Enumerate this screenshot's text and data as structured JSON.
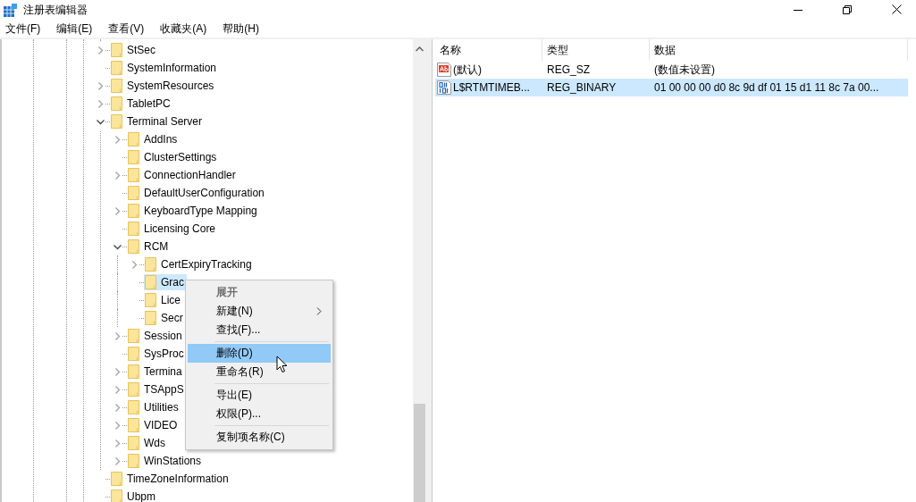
{
  "window": {
    "title": "注册表编辑器"
  },
  "menu_bar": [
    "文件(F)",
    "编辑(E)",
    "查看(V)",
    "收藏夹(A)",
    "帮助(H)"
  ],
  "tree": [
    {
      "label": "StSec",
      "kind": "branch",
      "expanded": false,
      "selected": false
    },
    {
      "label": "SystemInformation",
      "kind": "leaf",
      "selected": false
    },
    {
      "label": "SystemResources",
      "kind": "branch",
      "expanded": false,
      "selected": false
    },
    {
      "label": "TabletPC",
      "kind": "branch",
      "expanded": false,
      "selected": false
    },
    {
      "label": "Terminal Server",
      "kind": "branch",
      "expanded": true,
      "selected": false,
      "children": [
        {
          "label": "AddIns",
          "kind": "branch",
          "expanded": false,
          "selected": false
        },
        {
          "label": "ClusterSettings",
          "kind": "leaf",
          "selected": false
        },
        {
          "label": "ConnectionHandler",
          "kind": "branch",
          "expanded": false,
          "selected": false
        },
        {
          "label": "DefaultUserConfiguration",
          "kind": "leaf",
          "selected": false
        },
        {
          "label": "KeyboardType Mapping",
          "kind": "branch",
          "expanded": false,
          "selected": false
        },
        {
          "label": "Licensing Core",
          "kind": "leaf",
          "selected": false
        },
        {
          "label": "RCM",
          "kind": "branch",
          "expanded": true,
          "selected": false,
          "children": [
            {
              "label": "CertExpiryTracking",
              "kind": "branch",
              "expanded": false,
              "selected": false
            },
            {
              "label": "Grac",
              "kind": "leaf",
              "selected": true
            },
            {
              "label": "Lice",
              "kind": "leaf",
              "selected": false
            },
            {
              "label": "Secr",
              "kind": "leaf",
              "selected": false
            }
          ]
        },
        {
          "label": "Session",
          "kind": "branch",
          "expanded": false,
          "selected": false
        },
        {
          "label": "SysProc",
          "kind": "leaf",
          "selected": false
        },
        {
          "label": "Termina",
          "kind": "branch",
          "expanded": false,
          "selected": false
        },
        {
          "label": "TSAppS",
          "kind": "branch",
          "expanded": false,
          "selected": false
        },
        {
          "label": "Utilities",
          "kind": "branch",
          "expanded": false,
          "selected": false
        },
        {
          "label": "VIDEO",
          "kind": "branch",
          "expanded": false,
          "selected": false
        },
        {
          "label": "Wds",
          "kind": "branch",
          "expanded": false,
          "selected": false
        },
        {
          "label": "WinStations",
          "kind": "branch",
          "expanded": false,
          "selected": false
        }
      ]
    },
    {
      "label": "TimeZoneInformation",
      "kind": "leaf",
      "selected": false
    },
    {
      "label": "Ubpm",
      "kind": "leaf",
      "selected": false
    }
  ],
  "values": {
    "columns": [
      "名称",
      "类型",
      "数据"
    ],
    "rows": [
      {
        "kind": "string",
        "name": "(默认)",
        "type": "REG_SZ",
        "data": "(数值未设置)",
        "selected": false
      },
      {
        "kind": "binary",
        "name": "L$RTMTIMEB...",
        "type": "REG_BINARY",
        "data": "01 00 00 00 d0 8c 9d df 01 15 d1 11 8c 7a 00...",
        "selected": true
      }
    ]
  },
  "context_menu": [
    {
      "kind": "item",
      "label": "展开",
      "default": true,
      "disabled": true,
      "submenu": false,
      "selected": false
    },
    {
      "kind": "item",
      "label": "新建(N)",
      "default": false,
      "disabled": false,
      "submenu": true,
      "selected": false
    },
    {
      "kind": "item",
      "label": "查找(F)...",
      "default": false,
      "disabled": false,
      "submenu": false,
      "selected": false
    },
    {
      "kind": "separator"
    },
    {
      "kind": "item",
      "label": "删除(D)",
      "default": false,
      "disabled": false,
      "submenu": false,
      "selected": true
    },
    {
      "kind": "item",
      "label": "重命名(R)",
      "default": false,
      "disabled": false,
      "submenu": false,
      "selected": false
    },
    {
      "kind": "separator"
    },
    {
      "kind": "item",
      "label": "导出(E)",
      "default": false,
      "disabled": false,
      "submenu": false,
      "selected": false
    },
    {
      "kind": "item",
      "label": "权限(P)...",
      "default": false,
      "disabled": false,
      "submenu": false,
      "selected": false
    },
    {
      "kind": "separator"
    },
    {
      "kind": "item",
      "label": "复制项名称(C)",
      "default": false,
      "disabled": false,
      "submenu": false,
      "selected": false
    }
  ]
}
